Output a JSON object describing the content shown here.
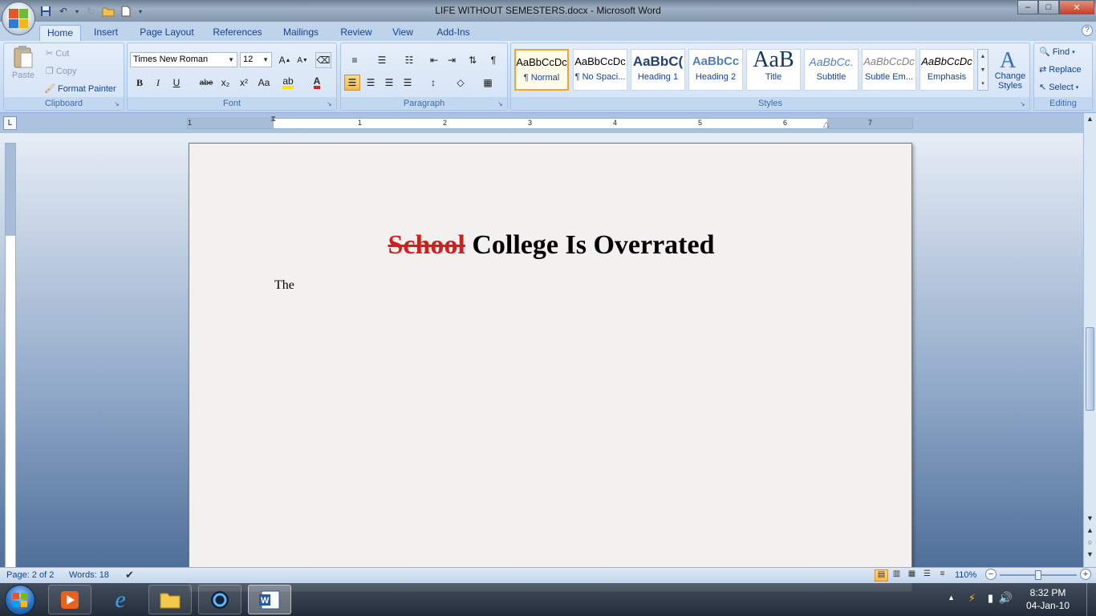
{
  "window": {
    "title": "LIFE WITHOUT SEMESTERS.docx - Microsoft Word"
  },
  "tabs": [
    "Home",
    "Insert",
    "Page Layout",
    "References",
    "Mailings",
    "Review",
    "View",
    "Add-Ins"
  ],
  "ribbon": {
    "clipboard": {
      "paste": "Paste",
      "cut": "Cut",
      "copy": "Copy",
      "format_painter": "Format Painter",
      "label": "Clipboard"
    },
    "font": {
      "name": "Times New Roman",
      "size": "12",
      "label": "Font",
      "bold": "B",
      "italic": "I",
      "underline": "U",
      "strike": "abe",
      "sub": "x₂",
      "sup": "x²",
      "case": "Aa"
    },
    "paragraph": {
      "label": "Paragraph"
    },
    "styles": {
      "label": "Styles",
      "change_styles": "Change Styles",
      "items": [
        {
          "sample": "AaBbCcDc",
          "name": "¶ Normal"
        },
        {
          "sample": "AaBbCcDc",
          "name": "¶ No Spaci..."
        },
        {
          "sample": "AaBbC(",
          "name": "Heading 1"
        },
        {
          "sample": "AaBbCc",
          "name": "Heading 2"
        },
        {
          "sample": "AaB",
          "name": "Title"
        },
        {
          "sample": "AaBbCc.",
          "name": "Subtitle"
        },
        {
          "sample": "AaBbCcDc",
          "name": "Subtle Em..."
        },
        {
          "sample": "AaBbCcDc",
          "name": "Emphasis"
        }
      ]
    },
    "editing": {
      "label": "Editing",
      "find": "Find",
      "replace": "Replace",
      "select": "Select"
    }
  },
  "ruler": {
    "labels": [
      "1",
      "1",
      "2",
      "3",
      "4",
      "5",
      "6",
      "7"
    ]
  },
  "document": {
    "title_struck": "School",
    "title_rest": "College Is Overrated",
    "body": "The"
  },
  "status": {
    "page": "Page: 2 of 2",
    "words": "Words: 18",
    "zoom": "110%"
  },
  "taskbar": {
    "time": "8:32 PM",
    "date": "04-Jan-10"
  },
  "colors": {
    "accent": "#15428b",
    "strike_red": "#d0201e"
  }
}
